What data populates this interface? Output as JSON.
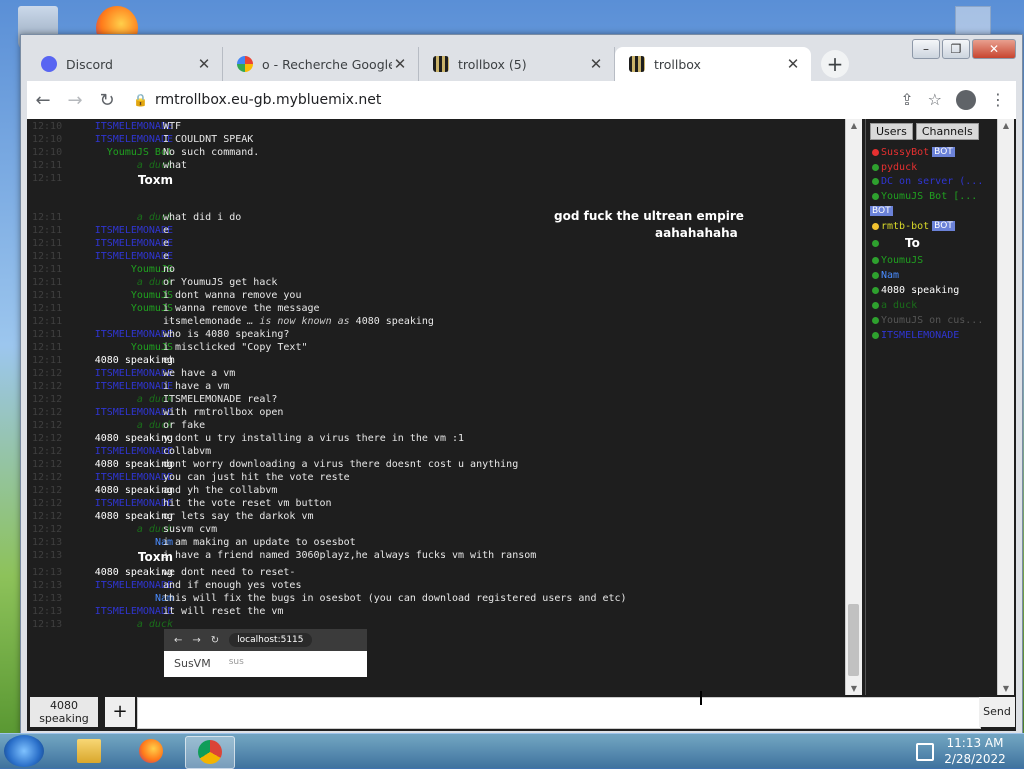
{
  "window": {
    "tabs": [
      {
        "label": "Discord",
        "icon": "discord-icon"
      },
      {
        "label": "o - Recherche Google",
        "icon": "google-icon"
      },
      {
        "label": "trollbox (5)",
        "icon": "trollbox-icon"
      },
      {
        "label": "trollbox",
        "icon": "trollbox-icon"
      }
    ],
    "url": "rmtrollbox.eu-gb.mybluemix.net"
  },
  "chat": {
    "lines": [
      {
        "t": "12:10",
        "n": "ITSMELEMONADE",
        "c": "blue",
        "m": "WTF"
      },
      {
        "t": "12:10",
        "n": "ITSMELEMONADE",
        "c": "blue",
        "m": "I COULDNT SPEAK"
      },
      {
        "t": "12:10",
        "n": "YoumuJS Bot",
        "c": "green",
        "m": "No such command."
      },
      {
        "t": "12:11",
        "n": "a duck",
        "c": "duck",
        "m": "what"
      },
      {
        "t": "12:11",
        "n": "Toxm",
        "c": "big",
        "m": ""
      },
      {
        "t": "12:11",
        "n": "a duck",
        "c": "duck",
        "m": "what did i do"
      },
      {
        "t": "12:11",
        "n": "ITSMELEMONADE",
        "c": "blue",
        "m": "e"
      },
      {
        "t": "12:11",
        "n": "ITSMELEMONADE",
        "c": "blue",
        "m": "e"
      },
      {
        "t": "12:11",
        "n": "ITSMELEMONADE",
        "c": "blue",
        "m": "e"
      },
      {
        "t": "12:11",
        "n": "YoumuJS",
        "c": "green",
        "m": "no"
      },
      {
        "t": "12:11",
        "n": "a duck",
        "c": "duck",
        "m": "or YoumuJS get hack"
      },
      {
        "t": "12:11",
        "n": "YoumuJS",
        "c": "green",
        "m": "i dont wanna remove you"
      },
      {
        "t": "12:11",
        "n": "YoumuJS",
        "c": "green",
        "m": "i wanna remove the message"
      },
      {
        "t": "12:11",
        "n": "~",
        "c": "dark",
        "m": "itsmelemonade",
        "m2": " … is now known as ",
        "m3": "4080 speaking"
      },
      {
        "t": "12:11",
        "n": "ITSMELEMONADE",
        "c": "blue",
        "m": "who is 4080 speaking?"
      },
      {
        "t": "12:11",
        "n": "YoumuJS",
        "c": "green",
        "m": "i misclicked \"Copy Text\""
      },
      {
        "t": "12:11",
        "n": "4080 speaking",
        "c": "white",
        "m": "eh"
      },
      {
        "t": "12:12",
        "n": "ITSMELEMONADE",
        "c": "blue",
        "m": "we have a vm"
      },
      {
        "t": "12:12",
        "n": "ITSMELEMONADE",
        "c": "blue",
        "m": "i have a vm"
      },
      {
        "t": "12:12",
        "n": "a duck",
        "c": "duck",
        "m": "ITSMELEMONADE real?"
      },
      {
        "t": "12:12",
        "n": "ITSMELEMONADE",
        "c": "blue",
        "m": "with rmtrollbox open"
      },
      {
        "t": "12:12",
        "n": "a duck",
        "c": "duck",
        "m": "or fake"
      },
      {
        "t": "12:12",
        "n": "4080 speaking",
        "c": "white",
        "m": "y dont u try installing a virus there in the vm :1"
      },
      {
        "t": "12:12",
        "n": "ITSMELEMONADE",
        "c": "blue",
        "m": "collabvm"
      },
      {
        "t": "12:12",
        "n": "4080 speaking",
        "c": "white",
        "m": "dont worry downloading a virus there doesnt cost u anything"
      },
      {
        "t": "12:12",
        "n": "ITSMELEMONADE",
        "c": "blue",
        "m": "you can just hit the vote reste"
      },
      {
        "t": "12:12",
        "n": "4080 speaking",
        "c": "white",
        "m": "and yh the collabvm"
      },
      {
        "t": "12:12",
        "n": "ITSMELEMONADE",
        "c": "blue",
        "m": "hit the vote reset vm button"
      },
      {
        "t": "12:12",
        "n": "4080 speaking",
        "c": "white",
        "m": "or lets say the darkok vm"
      },
      {
        "t": "12:12",
        "n": "a duck",
        "c": "duck",
        "m": "susvm cvm"
      },
      {
        "t": "12:13",
        "n": "Nam",
        "c": "nam",
        "m": "i am making an update to osesbot"
      },
      {
        "t": "12:13",
        "n": "Toxm",
        "c": "big",
        "m": "i have a friend named 3060playz,he always fucks vm with ransom"
      },
      {
        "t": "12:13",
        "n": "4080 speaking",
        "c": "white",
        "m": "we dont need to reset-"
      },
      {
        "t": "12:13",
        "n": "ITSMELEMONADE",
        "c": "blue",
        "m": "and if enough yes votes"
      },
      {
        "t": "12:13",
        "n": "Nam",
        "c": "nam",
        "m": "this will fix the bugs in osesbot (you can download registered users and etc)"
      },
      {
        "t": "12:13",
        "n": "ITSMELEMONADE",
        "c": "blue",
        "m": "it will reset the vm"
      },
      {
        "t": "12:13",
        "n": "a duck",
        "c": "duck",
        "m": ""
      }
    ],
    "big1": "god fuck the ultrean empire",
    "big2": "aahahahaha",
    "embedded": {
      "url": "localhost:5115",
      "title": "SusVM",
      "sub": "sus"
    }
  },
  "users_panel": {
    "tabs": [
      "Users",
      "Channels"
    ],
    "users": [
      {
        "name": "SussyBot",
        "color": "#e53030",
        "dot": "red",
        "bot": true
      },
      {
        "name": "pyduck",
        "color": "#e53030",
        "dot": "green"
      },
      {
        "name": "DC on server (...",
        "color": "#2f35d1",
        "dot": "green"
      },
      {
        "name": "YoumuJS Bot [...",
        "color": "#20a020",
        "dot": "green",
        "bot": true
      },
      {
        "name": "rmtb-bot",
        "color": "#dada2a",
        "dot": "yellow",
        "bot": true
      },
      {
        "name": "To",
        "color": "#ffffff",
        "dot": "green",
        "big": true
      },
      {
        "name": "YoumuJS",
        "color": "#20a020",
        "dot": "green"
      },
      {
        "name": "Nam",
        "color": "#4a8cff",
        "dot": "green"
      },
      {
        "name": "4080 speaking",
        "color": "#ffffff",
        "dot": "green"
      },
      {
        "name": "a duck",
        "color": "#1a6e1a",
        "dot": "green"
      },
      {
        "name": "YoumuJS on cus...",
        "color": "#555555",
        "dot": "green"
      },
      {
        "name": "ITSMELEMONADE",
        "color": "#2f35d1",
        "dot": "green"
      }
    ],
    "bot_label": "BOT"
  },
  "input": {
    "nick": "4080 speaking",
    "plus": "+",
    "send": "Send",
    "placeholder": ""
  },
  "taskbar": {
    "time": "11:13 AM",
    "date": "2/28/2022"
  }
}
